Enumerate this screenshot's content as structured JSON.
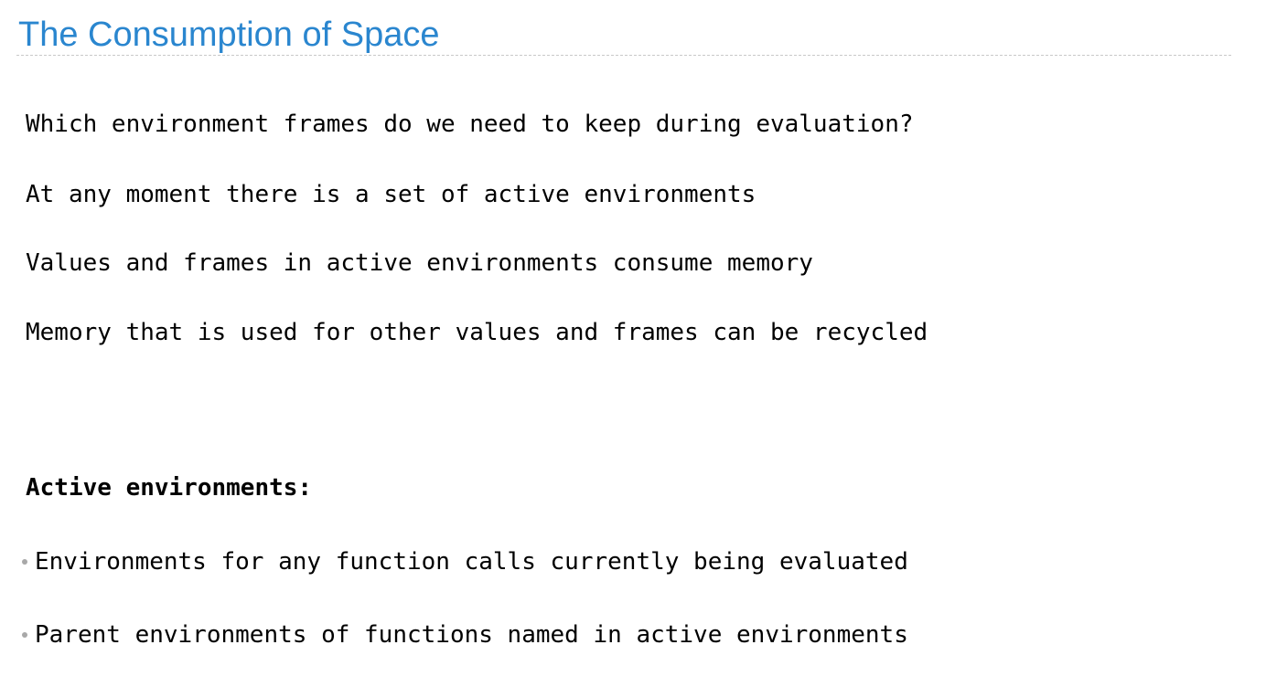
{
  "title": "The Consumption of Space",
  "paragraphs": [
    "Which environment frames do we need to keep during evaluation?",
    "At any moment there is a set of active environments",
    "Values and frames in active environments consume memory",
    "Memory that is used for other values and frames can be recycled"
  ],
  "section_heading": "Active environments:",
  "bullets": [
    "Environments for any function calls currently being evaluated",
    "Parent environments of functions named in active environments"
  ],
  "colors": {
    "title": "#2a86cf",
    "text": "#000000",
    "bullet": "#a8a8a8",
    "rule": "#c8c8c8"
  }
}
